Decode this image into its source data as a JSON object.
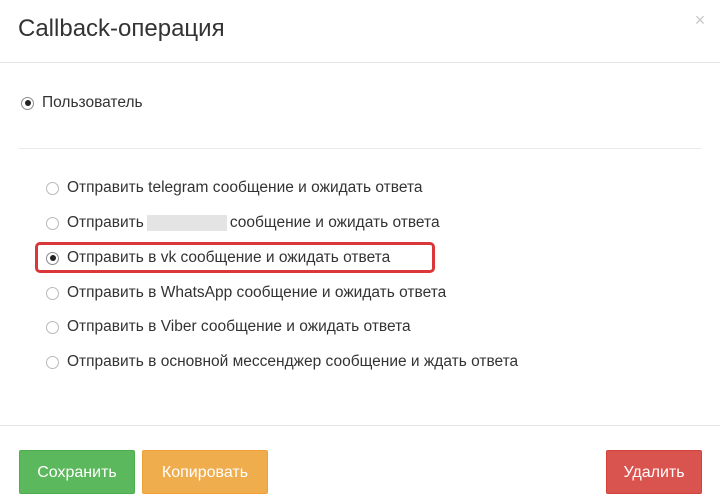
{
  "dialog": {
    "title": "Callback-операция",
    "close_glyph": "×"
  },
  "top_option": {
    "label": "Пользователь",
    "checked": true
  },
  "options": [
    {
      "label": "Отправить telegram сообщение и ожидать ответа",
      "checked": false
    },
    {
      "label_before": "Отправить",
      "label_after": "сообщение и ожидать ответа",
      "redacted": true,
      "checked": false
    },
    {
      "label": "Отправить в vk сообщение и ожидать ответа",
      "checked": true,
      "highlighted": true
    },
    {
      "label": "Отправить в WhatsApp сообщение и ожидать ответа",
      "checked": false
    },
    {
      "label": "Отправить в Viber сообщение и ожидать ответа",
      "checked": false
    },
    {
      "label": "Отправить в основной мессенджер сообщение и ждать ответа",
      "checked": false
    }
  ],
  "footer": {
    "save_label": "Сохранить",
    "copy_label": "Копировать",
    "delete_label": "Удалить"
  },
  "colors": {
    "save": "#5cb85c",
    "copy": "#f0ad4e",
    "delete": "#d9534f",
    "highlight": "#d9373a"
  }
}
